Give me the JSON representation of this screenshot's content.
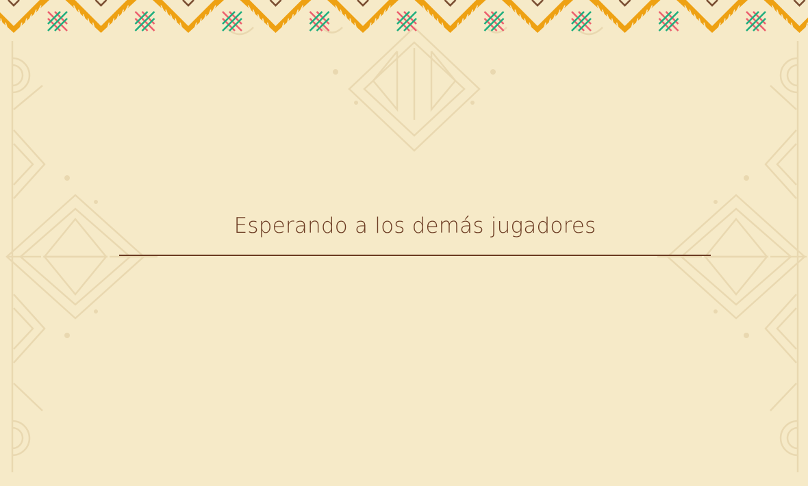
{
  "screen": {
    "message": "Esperando a los demás jugadores"
  },
  "theme": {
    "background": "#f6eac8",
    "pattern": "#ead9b2",
    "border_orange": "#eea113",
    "border_brown": "#7a4e32",
    "cross_red": "#ec5f6e",
    "cross_green": "#1fae7e",
    "text": "#6b3b22"
  },
  "icons": {
    "border_motif": "zigzag-cross-stitch"
  }
}
